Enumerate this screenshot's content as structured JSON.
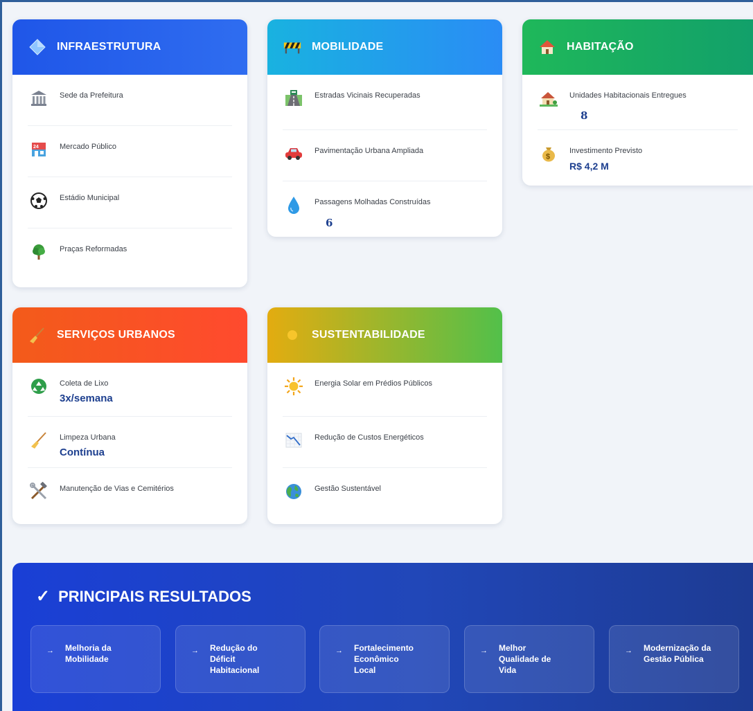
{
  "infra": {
    "title": "INFRAESTRUTURA",
    "icon": "diamond-icon",
    "color": "#2f6df0",
    "items": [
      {
        "label": "Sede da Prefeitura",
        "icon": "classical-building-icon"
      },
      {
        "label": "Mercado Público",
        "icon": "convenience-store-icon"
      },
      {
        "label": "Estádio Municipal",
        "icon": "soccer-ball-icon"
      },
      {
        "label": "Praças Reformadas",
        "icon": "tree-icon"
      }
    ]
  },
  "mob": {
    "title": "MOBILIDADE",
    "icon": "construction-barrier-icon",
    "color": "#2a8cf5",
    "items": [
      {
        "label": "Estradas Vicinais Recuperadas",
        "icon": "road-icon"
      },
      {
        "label": "Pavimentação Urbana Ampliada",
        "icon": "car-icon"
      },
      {
        "label": "Passagens Molhadas Construídas",
        "icon": "water-drop-icon",
        "value": "6"
      }
    ]
  },
  "hab": {
    "title": "HABITAÇÃO",
    "icon": "house-icon",
    "color": "#1fb85a",
    "items": [
      {
        "label": "Unidades Habitacionais Entregues",
        "icon": "house-garden-icon",
        "value": "8"
      },
      {
        "label": "Investimento Previsto",
        "icon": "money-bag-icon",
        "value": "R$ 4,2 M"
      }
    ]
  },
  "serv": {
    "title": "SERVIÇOS URBANOS",
    "icon": "broom-icon",
    "color": "#f35b1a",
    "items": [
      {
        "label": "Coleta de Lixo",
        "icon": "recycle-icon",
        "value": "3x/semana"
      },
      {
        "label": "Limpeza Urbana",
        "icon": "broom-icon",
        "value": "Contínua"
      },
      {
        "label": "Manutenção de Vias e Cemitérios",
        "icon": "tools-icon"
      }
    ]
  },
  "sus": {
    "title": "SUSTENTABILIDADE",
    "icon": "sun-dot-icon",
    "color": "#e3ac10",
    "items": [
      {
        "label": "Energia Solar em Prédios Públicos",
        "icon": "sun-icon"
      },
      {
        "label": "Redução de Custos Energéticos",
        "icon": "chart-decreasing-icon"
      },
      {
        "label": "Gestão Sustentável",
        "icon": "globe-icon"
      }
    ]
  },
  "results": {
    "title": "PRINCIPAIS RESULTADOS",
    "check": "✓",
    "arrow": "→",
    "items": [
      "Melhoria da\nMobilidade",
      "Redução do\nDéficit\nHabitacional",
      "Fortalecimento\nEconômico\nLocal",
      "Melhor\nQualidade de\nVida",
      "Modernização da\nGestão Pública"
    ]
  }
}
